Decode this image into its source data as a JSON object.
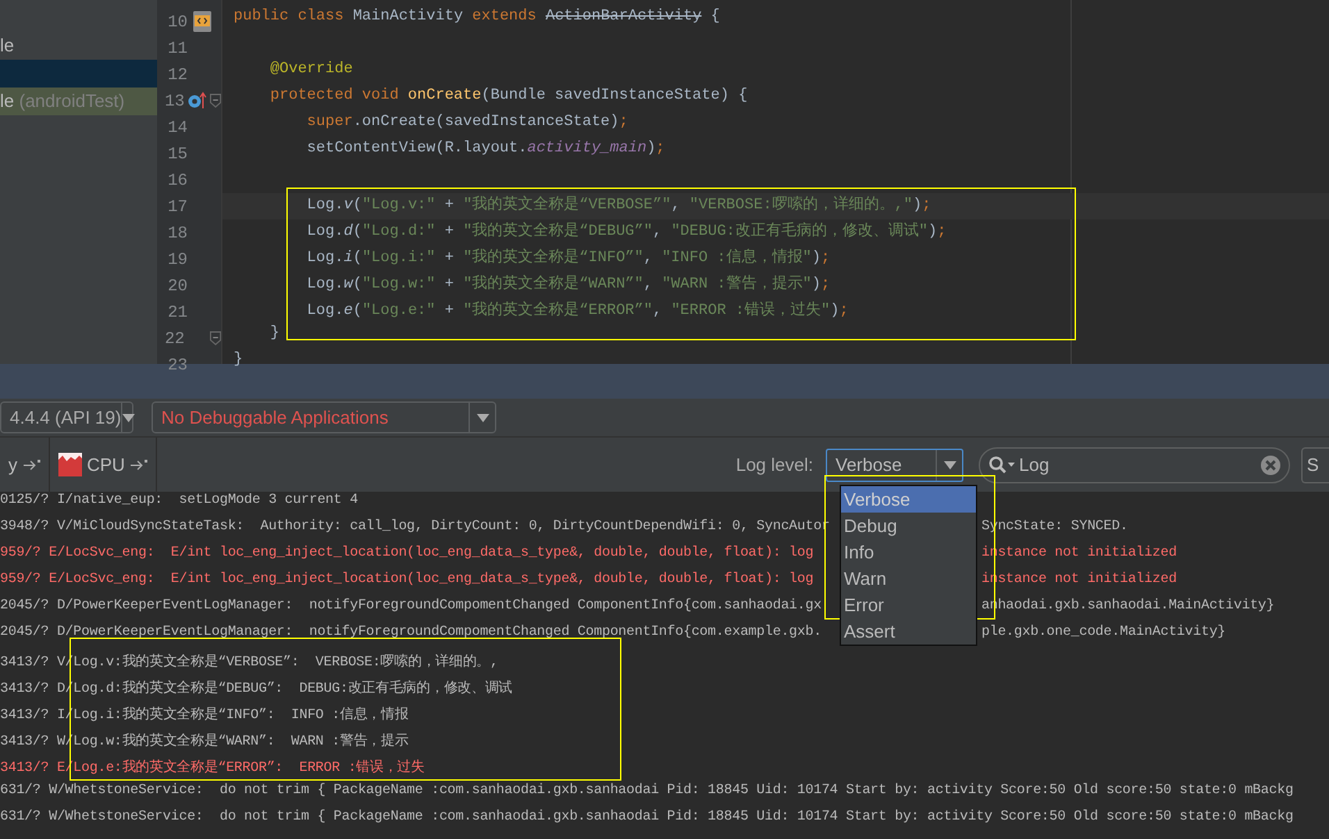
{
  "sidebar": {
    "items": [
      {
        "label": "le",
        "selected": false
      },
      {
        "selected": true
      },
      {
        "label": "le",
        "note": "(androidTest)",
        "selected": false,
        "highlighted": true
      }
    ]
  },
  "editor": {
    "lines": [
      {
        "number": "10",
        "kind": "class",
        "tokens": [
          {
            "kind": "keyword",
            "text": "public class "
          },
          {
            "kind": "plain",
            "text": "MainActivity "
          },
          {
            "kind": "keyword",
            "text": "extends "
          },
          {
            "kind": "deprecated",
            "text": "ActionBarActivity"
          },
          {
            "kind": "plain",
            "text": " {"
          }
        ]
      },
      {
        "number": "11"
      },
      {
        "number": "12",
        "tokens": [
          {
            "kind": "annotation",
            "text": "    @Override"
          }
        ]
      },
      {
        "number": "13",
        "kind": "override",
        "fold": true,
        "tokens": [
          {
            "kind": "keyword",
            "text": "    protected void "
          },
          {
            "kind": "method",
            "text": "onCreate"
          },
          {
            "kind": "plain",
            "text": "(Bundle savedInstanceState) {"
          }
        ]
      },
      {
        "number": "14",
        "tokens": [
          {
            "kind": "keyword",
            "text": "        super"
          },
          {
            "kind": "plain",
            "text": ".onCreate(savedInstanceState)"
          },
          {
            "kind": "keyword",
            "text": ";"
          }
        ]
      },
      {
        "number": "15",
        "tokens": [
          {
            "kind": "plain",
            "text": "        setContentView(R.layout."
          },
          {
            "kind": "field",
            "text": "activity_main"
          },
          {
            "kind": "plain",
            "text": ")"
          },
          {
            "kind": "keyword",
            "text": ";"
          }
        ]
      },
      {
        "number": "16"
      },
      {
        "number": "17",
        "current": true,
        "tokens": [
          {
            "kind": "plain",
            "text": "        Log."
          },
          {
            "kind": "static",
            "text": "v"
          },
          {
            "kind": "plain",
            "text": "("
          },
          {
            "kind": "string",
            "text": "\"Log.v:\""
          },
          {
            "kind": "plain",
            "text": " + "
          },
          {
            "kind": "string",
            "text": "\"我的英文全称是“VERBOSE”\""
          },
          {
            "kind": "plain",
            "text": ", "
          },
          {
            "kind": "string",
            "text": "\"VERBOSE:啰嗦的，详细的。,\""
          },
          {
            "kind": "plain",
            "text": ")"
          },
          {
            "kind": "keyword",
            "text": ";"
          }
        ]
      },
      {
        "number": "18",
        "tokens": [
          {
            "kind": "plain",
            "text": "        Log."
          },
          {
            "kind": "static",
            "text": "d"
          },
          {
            "kind": "plain",
            "text": "("
          },
          {
            "kind": "string",
            "text": "\"Log.d:\""
          },
          {
            "kind": "plain",
            "text": " + "
          },
          {
            "kind": "string",
            "text": "\"我的英文全称是“DEBUG”\""
          },
          {
            "kind": "plain",
            "text": ", "
          },
          {
            "kind": "string",
            "text": "\"DEBUG:改正有毛病的，修改、调试\""
          },
          {
            "kind": "plain",
            "text": ")"
          },
          {
            "kind": "keyword",
            "text": ";"
          }
        ]
      },
      {
        "number": "19",
        "tokens": [
          {
            "kind": "plain",
            "text": "        Log."
          },
          {
            "kind": "static",
            "text": "i"
          },
          {
            "kind": "plain",
            "text": "("
          },
          {
            "kind": "string",
            "text": "\"Log.i:\""
          },
          {
            "kind": "plain",
            "text": " + "
          },
          {
            "kind": "string",
            "text": "\"我的英文全称是“INFO”\""
          },
          {
            "kind": "plain",
            "text": ", "
          },
          {
            "kind": "string",
            "text": "\"INFO :信息，情报\""
          },
          {
            "kind": "plain",
            "text": ")"
          },
          {
            "kind": "keyword",
            "text": ";"
          }
        ]
      },
      {
        "number": "20",
        "tokens": [
          {
            "kind": "plain",
            "text": "        Log."
          },
          {
            "kind": "static",
            "text": "w"
          },
          {
            "kind": "plain",
            "text": "("
          },
          {
            "kind": "string",
            "text": "\"Log.w:\""
          },
          {
            "kind": "plain",
            "text": " + "
          },
          {
            "kind": "string",
            "text": "\"我的英文全称是“WARN”\""
          },
          {
            "kind": "plain",
            "text": ", "
          },
          {
            "kind": "string",
            "text": "\"WARN :警告，提示\""
          },
          {
            "kind": "plain",
            "text": ")"
          },
          {
            "kind": "keyword",
            "text": ";"
          }
        ]
      },
      {
        "number": "21",
        "tokens": [
          {
            "kind": "plain",
            "text": "        Log."
          },
          {
            "kind": "static",
            "text": "e"
          },
          {
            "kind": "plain",
            "text": "("
          },
          {
            "kind": "string",
            "text": "\"Log.e:\""
          },
          {
            "kind": "plain",
            "text": " + "
          },
          {
            "kind": "string",
            "text": "\"我的英文全称是“ERROR”\""
          },
          {
            "kind": "plain",
            "text": ", "
          },
          {
            "kind": "string",
            "text": "\"ERROR :错误，过失\""
          },
          {
            "kind": "plain",
            "text": ")"
          },
          {
            "kind": "keyword",
            "text": ";"
          }
        ]
      },
      {
        "number": "22",
        "fold": true,
        "tokens": [
          {
            "kind": "plain",
            "text": "    }"
          }
        ]
      },
      {
        "number": "23",
        "tokens": [
          {
            "kind": "plain",
            "text": "}"
          }
        ]
      }
    ]
  },
  "toolbar": {
    "device": "4.4.4 (API 19)",
    "app": "No Debuggable Applications"
  },
  "tabs": [
    {
      "label": "y"
    },
    {
      "label": "CPU"
    }
  ],
  "log_level": {
    "label": "Log level:",
    "value": "Verbose",
    "options": [
      {
        "label": "Verbose",
        "selected": true
      },
      {
        "label": "Debug",
        "selected": false
      },
      {
        "label": "Info",
        "selected": false
      },
      {
        "label": "Warn",
        "selected": false
      },
      {
        "label": "Error",
        "selected": false
      },
      {
        "label": "Assert",
        "selected": false
      }
    ]
  },
  "search": {
    "value": "Log"
  },
  "cut_button": "S",
  "log": [
    {
      "kind": "info",
      "text": "0125/? I/native_eup:  setLogMode 3 current 4"
    },
    {
      "kind": "verbose",
      "text": "3948/? V/MiCloudSyncStateTask:  Authority: call_log, DirtyCount: 0, DirtyCountDependWifi: 0, SyncAutor",
      "after": "SyncState: SYNCED."
    },
    {
      "kind": "error",
      "text": "959/? E/LocSvc_eng:  E/int loc_eng_inject_location(loc_eng_data_s_type&, double, double, float): log",
      "after": "instance not initialized"
    },
    {
      "kind": "error",
      "text": "959/? E/LocSvc_eng:  E/int loc_eng_inject_location(loc_eng_data_s_type&, double, double, float): log",
      "after": "instance not initialized"
    },
    {
      "kind": "debug",
      "text": "2045/? D/PowerKeeperEventLogManager:  notifyForegroundCompomentChanged ComponentInfo{com.sanhaodai.gx",
      "after": "anhaodai.gxb.sanhaodai.MainActivity}"
    },
    {
      "kind": "debug",
      "text": "2045/? D/PowerKeeperEventLogManager:  notifyForegroundCompomentChanged ComponentInfo{com.example.gxb.",
      "after": "ple.gxb.one_code.MainActivity}"
    },
    {
      "kind": "verbose",
      "text": "3413/? V/Log.v:我的英文全称是“VERBOSE”:  VERBOSE:啰嗦的，详细的。,"
    },
    {
      "kind": "debug",
      "text": "3413/? D/Log.d:我的英文全称是“DEBUG”:  DEBUG:改正有毛病的，修改、调试"
    },
    {
      "kind": "info",
      "text": "3413/? I/Log.i:我的英文全称是“INFO”:  INFO :信息，情报"
    },
    {
      "kind": "warn",
      "text": "3413/? W/Log.w:我的英文全称是“WARN”:  WARN :警告，提示"
    },
    {
      "kind": "error",
      "text": "3413/? E/Log.e:我的英文全称是“ERROR”:  ERROR :错误，过失"
    },
    {
      "kind": "warn",
      "text": "631/? W/WhetstoneService:  do not trim { PackageName :com.sanhaodai.gxb.sanhaodai Pid: 18845 Uid: 10174 Start by: activity Score:50 Old score:50 state:0 mBackg"
    },
    {
      "kind": "warn",
      "text": "631/? W/WhetstoneService:  do not trim { PackageName :com.sanhaodai.gxb.sanhaodai Pid: 18845 Uid: 10174 Start by: activity Score:50 Old score:50 state:0 mBackg"
    }
  ]
}
